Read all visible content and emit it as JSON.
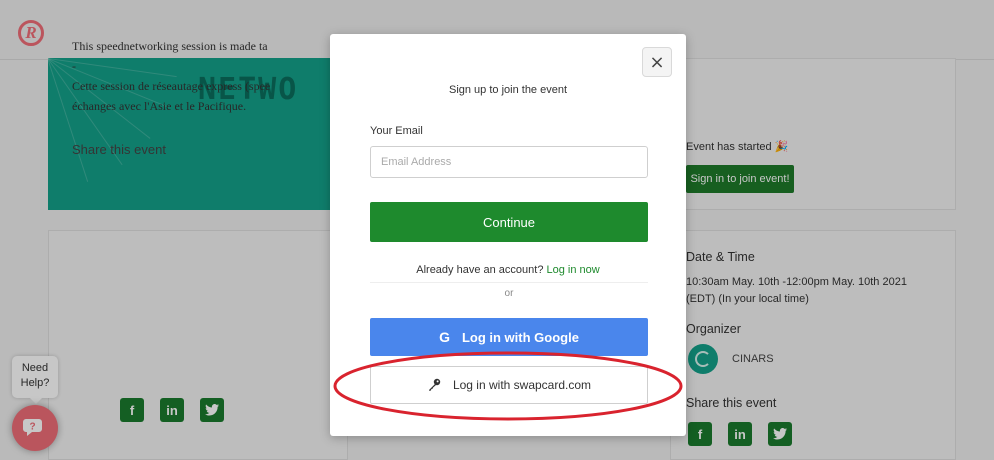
{
  "app": {
    "logo_letter": "R"
  },
  "banner": {
    "text": "NETWO"
  },
  "event": {
    "status": "Event has started",
    "status_icon": "party-popper-icon",
    "sign_in_label": "Sign in to join event!",
    "description_line1": "This speednetworking session is made ta",
    "description_dash": "-",
    "description_line2": "Cette session de réseautage express (spee",
    "description_line3": "échanges avec l'Asie et le Pacifique.",
    "share_title": "Share this event",
    "date_title": "Date & Time",
    "date_text": "10:30am May. 10th -12:00pm May. 10th 2021 (EDT) (In your local time)",
    "organizer_title": "Organizer",
    "organizer_name": "CINARS",
    "share_title_right": "Share this event"
  },
  "social": {
    "facebook": "f",
    "linkedin": "in",
    "twitter": "t"
  },
  "help": {
    "line1": "Need",
    "line2": "Help?"
  },
  "modal": {
    "title": "Sign up to join the event",
    "email_label": "Your Email",
    "email_placeholder": "Email Address",
    "continue_label": "Continue",
    "account_prompt": "Already have an account?",
    "login_now": "Log in now",
    "or_label": "or",
    "google_label": "Log in with Google",
    "google_icon": "G",
    "swapcard_label": "Log in with swapcard.com",
    "close_icon": "×"
  },
  "colors": {
    "brand_green": "#1e8a2d",
    "google_blue": "#4a86ec",
    "annotation_red": "#d9232e"
  }
}
